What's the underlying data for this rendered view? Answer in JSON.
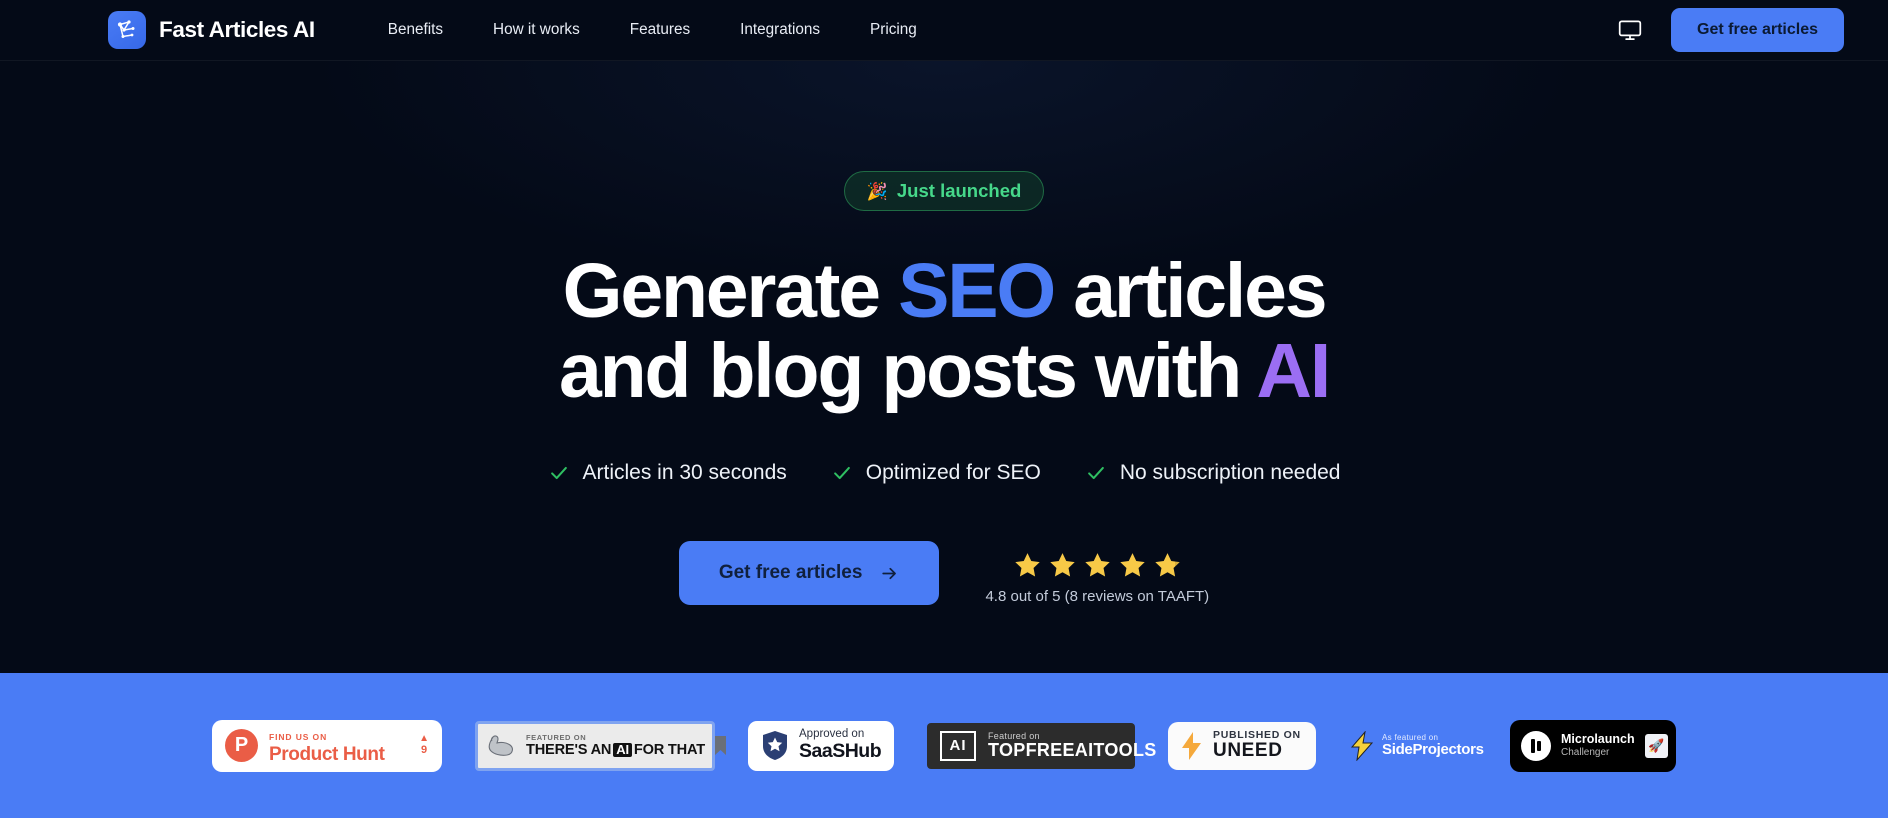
{
  "brand": {
    "name": "Fast Articles AI",
    "logo_icon": "network-share-icon",
    "accent": "#4a7cf5"
  },
  "nav": {
    "links": [
      {
        "label": "Benefits"
      },
      {
        "label": "How it works"
      },
      {
        "label": "Features"
      },
      {
        "label": "Integrations"
      },
      {
        "label": "Pricing"
      }
    ],
    "display_icon": "monitor-icon",
    "cta_label": "Get free articles"
  },
  "hero": {
    "badge": {
      "emoji": "🎉",
      "label": "Just launched",
      "color": "#46d88a"
    },
    "headline": {
      "line1_a": "Generate ",
      "line1_highlight": "SEO",
      "line1_b": " articles",
      "line2_a": "and blog posts with ",
      "line2_highlight": "AI",
      "seo_color": "#4a7cf5",
      "ai_color": "#9b6ef3"
    },
    "features": [
      {
        "icon": "check-icon",
        "label": "Articles in 30 seconds"
      },
      {
        "icon": "check-icon",
        "label": "Optimized for SEO"
      },
      {
        "icon": "check-icon",
        "label": "No subscription needed"
      }
    ],
    "cta": {
      "label": "Get free articles",
      "icon": "arrow-right-icon"
    },
    "rating": {
      "stars": 5,
      "value": "4.8",
      "text": "4.8 out of 5 (8 reviews on TAAFT)",
      "star_color": "#f7c947"
    }
  },
  "badges": {
    "background": "#4a7cf5",
    "product_hunt": {
      "small": "FIND US ON",
      "big": "Product Hunt",
      "initial": "P",
      "votes": "9",
      "color": "#ea5d46"
    },
    "taaft": {
      "small": "FEATURED ON",
      "big_before": "THERE'S AN",
      "chip": "AI",
      "big_after": "FOR THAT",
      "icon": "flexed-arm-icon",
      "bookmark_icon": "bookmark-icon"
    },
    "saashub": {
      "small": "Approved on",
      "big": "SaaSHub",
      "icon": "shield-star-icon"
    },
    "topfreeaitools": {
      "chip": "AI",
      "small": "Featured on",
      "big": "TOPFREEAITOOLS"
    },
    "uneed": {
      "small": "PUBLISHED ON",
      "big": "UNEED",
      "icon": "lightning-bolt-icon"
    },
    "sideprojectors": {
      "small": "As featured on",
      "big": "SideProjectors",
      "icon": "lightning-bolt-icon"
    },
    "microlaunch": {
      "big": "Microlaunch",
      "small": "Challenger",
      "icon": "microlaunch-logo-icon",
      "award_icon": "🚀"
    }
  }
}
